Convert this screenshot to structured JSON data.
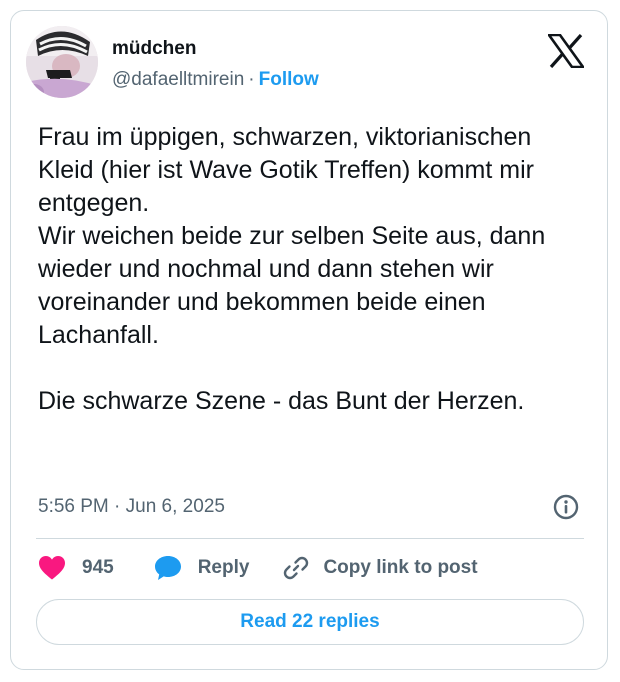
{
  "author": {
    "display_name": "müdchen",
    "handle": "@dafaelltmirein",
    "separator": "·",
    "follow_label": "Follow"
  },
  "tweet": {
    "text": "Frau im üppigen, schwarzen, viktorianischen Kleid (hier ist Wave Gotik Treffen) kommt mir entgegen.\nWir weichen beide zur selben Seite aus, dann wieder und nochmal und dann stehen wir voreinander und bekommen beide einen Lachanfall.\n\nDie schwarze Szene - das Bunt der Herzen.",
    "timestamp": "5:56 PM · Jun 6, 2025"
  },
  "actions": {
    "like_count": "945",
    "reply_label": "Reply",
    "copy_link_label": "Copy link to post"
  },
  "footer": {
    "read_replies_label": "Read 22 replies"
  },
  "icons": {
    "logo": "x-logo-icon",
    "info": "info-icon",
    "like": "heart-icon",
    "reply": "speech-bubble-icon",
    "copy": "link-icon"
  },
  "colors": {
    "accent": "#1d9bf0",
    "like": "#f91880",
    "muted": "#536471",
    "border": "#cfd9de"
  }
}
